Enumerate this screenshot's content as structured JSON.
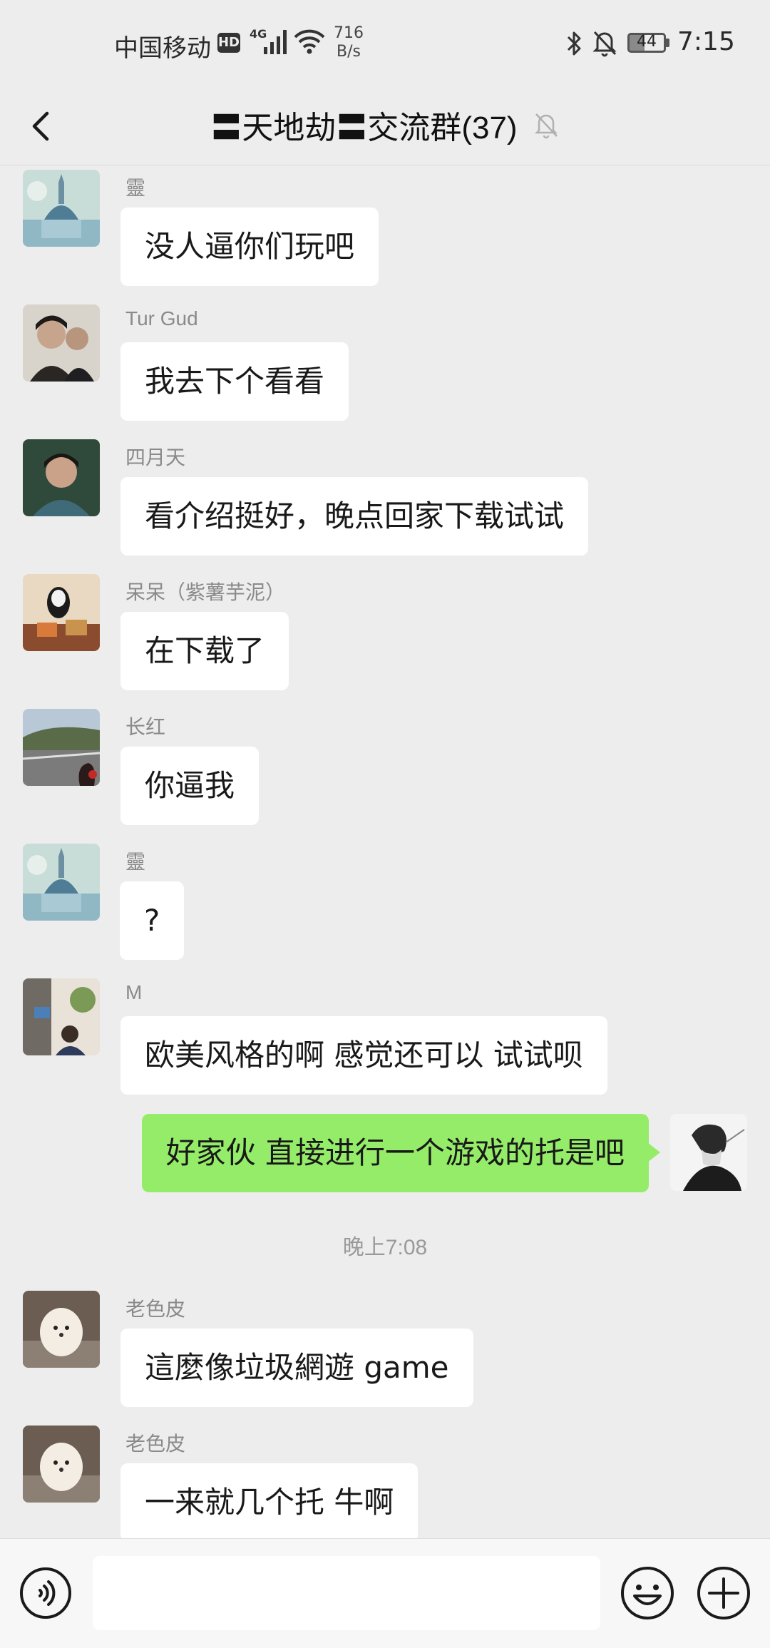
{
  "status_bar": {
    "carrier": "中国移动",
    "hd_badge": "HD",
    "network": "4G",
    "speed_value": "716",
    "speed_unit": "B/s",
    "battery": "44",
    "time": "7:15"
  },
  "header": {
    "title": "〓天地劫〓交流群(37)",
    "back_icon": "chevron-left-icon",
    "mute_icon": "bell-off-icon"
  },
  "messages": [
    {
      "sender": "靈",
      "text": "没人逼你们玩吧"
    },
    {
      "sender": "Tur Gud",
      "text": "我去下个看看"
    },
    {
      "sender": "四月天",
      "text": "看介绍挺好，晚点回家下载试试"
    },
    {
      "sender": "呆呆（紫薯芋泥）",
      "text": "在下载了"
    },
    {
      "sender": "长红",
      "text": "你逼我"
    },
    {
      "sender": "靈",
      "text": "?"
    },
    {
      "sender": "M",
      "text": "欧美风格的啊  感觉还可以 试试呗"
    },
    {
      "sender": "",
      "text": "好家伙 直接进行一个游戏的托是吧",
      "mine": true
    },
    {
      "sender": "老色皮",
      "text": "這麼像垃圾網遊 game"
    },
    {
      "sender": "老色皮",
      "text": "一来就几个托 牛啊"
    }
  ],
  "timestamp": "晚上7:08",
  "input_bar": {
    "voice_icon": "voice-icon",
    "emoji_icon": "emoji-icon",
    "plus_icon": "plus-icon"
  },
  "colors": {
    "background": "#EDEDED",
    "bubble_other": "#FFFFFF",
    "bubble_mine": "#95EC69",
    "sender_name": "#8A8A8A"
  }
}
